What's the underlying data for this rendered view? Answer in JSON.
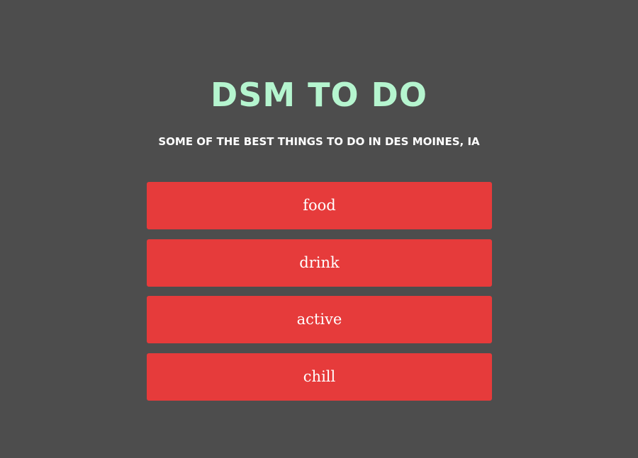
{
  "header": {
    "title": "DSM TO DO",
    "subtitle": "SOME OF THE BEST THINGS TO DO IN DES MOINES, IA"
  },
  "menu": {
    "items": [
      {
        "label": "food"
      },
      {
        "label": "drink"
      },
      {
        "label": "active"
      },
      {
        "label": "chill"
      }
    ]
  },
  "colors": {
    "background": "#4d4d4d",
    "title": "#b5f5cf",
    "button": "#e63b3b",
    "button_text": "#ffffff"
  }
}
